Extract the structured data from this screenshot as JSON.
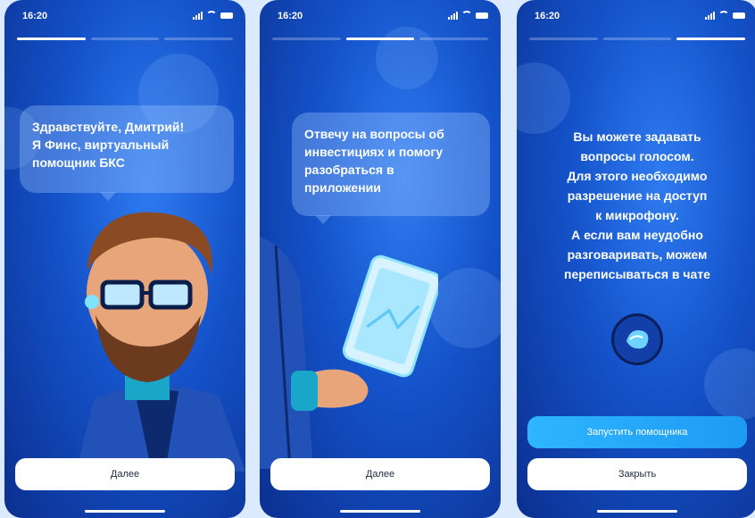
{
  "screens": [
    {
      "time": "16:20",
      "progress": [
        1,
        0,
        0
      ],
      "lines": [
        "Здравствуйте, Дмитрий!",
        "Я Финс, виртуальный",
        "помощник БКС"
      ],
      "button": "Далее"
    },
    {
      "time": "16:20",
      "progress": [
        0,
        1,
        0
      ],
      "lines": [
        "Отвечу на вопросы об",
        "инвестициях и помогу",
        "разобраться в",
        "приложении"
      ],
      "button": "Далее"
    },
    {
      "time": "16:20",
      "progress": [
        0,
        0,
        1
      ],
      "lines": [
        "Вы можете задавать",
        "вопросы голосом.",
        "Для этого необходимо",
        "разрешение на доступ",
        "к микрофону.",
        "А если вам неудобно",
        "разговаривать, можем",
        "переписываться в чате"
      ],
      "primary_button": "Запустить помощника",
      "secondary_button": "Закрыть",
      "assistant_icon": "assistant-logo-icon"
    }
  ],
  "colors": {
    "accent": "#1d9af3",
    "bg": "#1452c9"
  }
}
